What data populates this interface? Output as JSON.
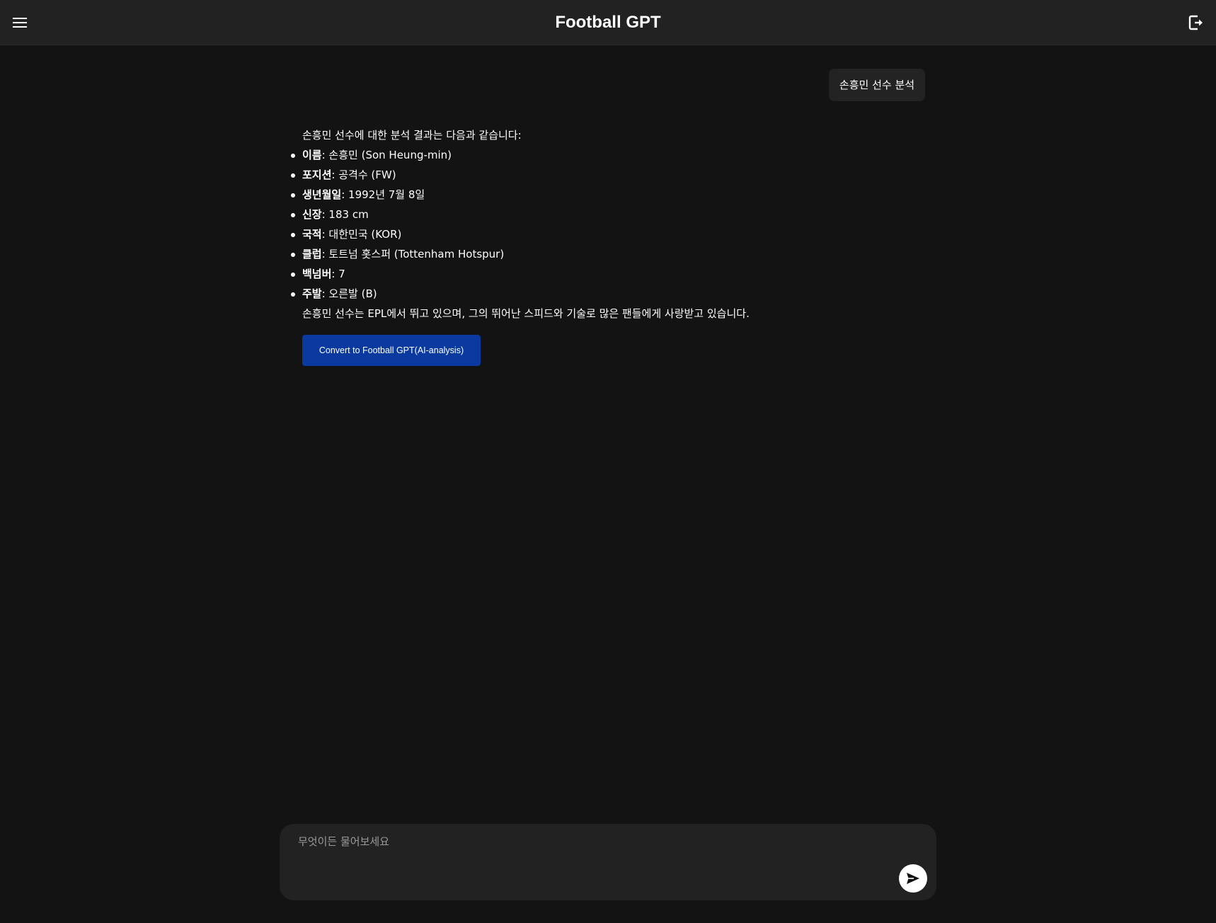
{
  "header": {
    "title": "Football GPT",
    "menu_icon": "hamburger-menu-icon",
    "logout_icon": "logout-icon"
  },
  "user_message": "손흥민 선수 분석",
  "bot_message": {
    "intro": "손흥민 선수에 대한 분석 결과는 다음과 같습니다:",
    "details": [
      {
        "key": "이름",
        "value": ": 손흥민 (Son Heung-min)"
      },
      {
        "key": "포지션",
        "value": ": 공격수 (FW)"
      },
      {
        "key": "생년월일",
        "value": ": 1992년 7월 8일"
      },
      {
        "key": "신장",
        "value": ": 183 cm"
      },
      {
        "key": "국적",
        "value": ": 대한민국 (KOR)"
      },
      {
        "key": "클럽",
        "value": ": 토트넘 홋스퍼 (Tottenham Hotspur)"
      },
      {
        "key": "백넘버",
        "value": ": 7"
      },
      {
        "key": "주발",
        "value": ": 오른발 (B)"
      }
    ],
    "outro": "손흥민 선수는 EPL에서 뛰고 있으며, 그의 뛰어난 스피드와 기술로 많은 팬들에게 사랑받고 있습니다.",
    "convert_button": "Convert to Football GPT(AI-analysis)"
  },
  "composer": {
    "placeholder": "무엇이든 물어보세요",
    "value": "",
    "send_icon": "send-icon"
  },
  "colors": {
    "background": "#131313",
    "header": "#222222",
    "bubble": "#232323",
    "accent_button": "#0a3aa0"
  }
}
